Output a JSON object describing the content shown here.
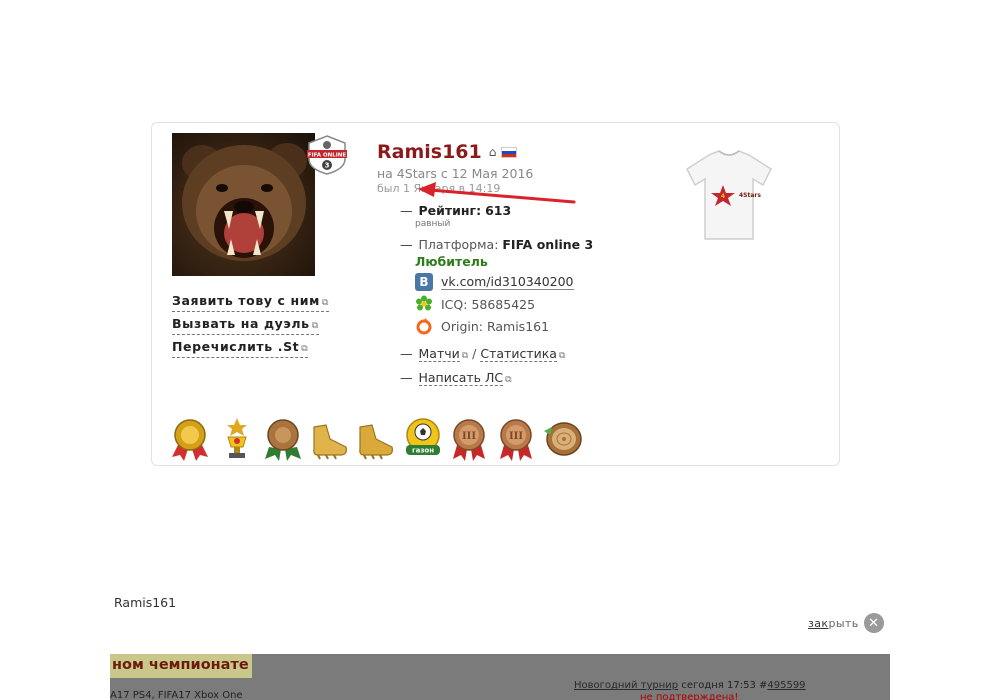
{
  "profile": {
    "username": "Ramis161",
    "member_since": "на 4Stars с 12 Мая 2016",
    "last_seen": "был 1 Января в 14:19",
    "rating_label": "Рейтинг:",
    "rating_value": "613",
    "rating_sub": "равный",
    "platform_label": "Платформа:",
    "platform_value": "FIFA online 3",
    "skill": "Любитель",
    "vk": "vk.com/id310340200",
    "icq": "ICQ:  58685425",
    "origin": "Origin: Ramis161",
    "matches": "Матчи",
    "separator": "/",
    "statistics": "Статистика",
    "write_pm": "Написать ЛС"
  },
  "badge": {
    "text": "FIFA ONLINE",
    "number": "3"
  },
  "tshirt": {
    "text": "4Stars"
  },
  "actions": [
    "Заявить тову с ним",
    "Вызвать на дуэль",
    "Перечислить .St"
  ],
  "medal_icons": [
    "gold-medal-icon",
    "cup-trophy-icon",
    "bronze-wreath-medal-icon",
    "golden-boot-icon",
    "golden-boot-icon",
    "gazon-ball-medal-icon",
    "bronze-iii-medal-icon",
    "bronze-iii-medal-icon",
    "wooden-log-icon"
  ],
  "medal_gazon_text": "газон",
  "medal_roman": "III",
  "caption": "Ramis161",
  "close": {
    "prefix": "зак",
    "suffix": "рыть",
    "icon": "✕"
  },
  "background": {
    "title": "ном чемпионате",
    "subtitle": "A17 PS4, FIFA17 Xbox One",
    "news_link": "Новогодний турнир",
    "news_rest": " сегодня 17:53 #",
    "news_id": "495599",
    "status": "не подтверждена!"
  },
  "colors": {
    "username": "#8b1a1a",
    "skill": "#2e7d1a",
    "arrow": "#d9232a",
    "status": "#b00000"
  }
}
